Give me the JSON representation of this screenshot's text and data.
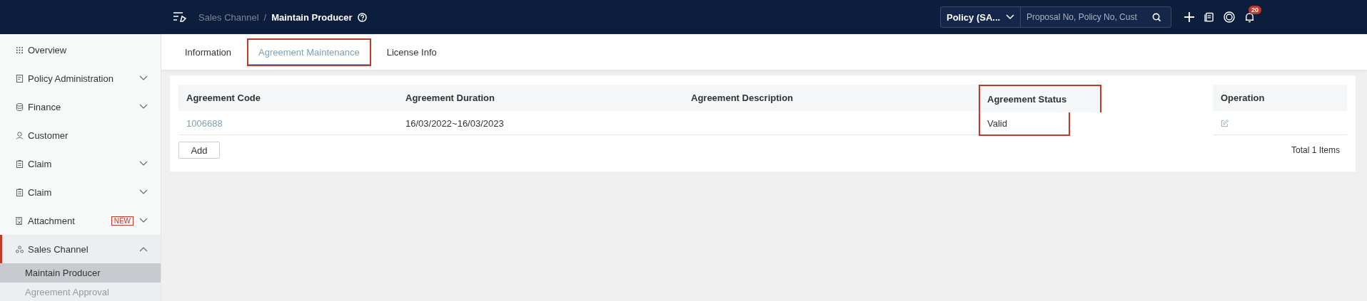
{
  "top_bar": {
    "breadcrumb_separator": "/",
    "breadcrumb": [
      {
        "label": "Sales Channel",
        "current": false
      },
      {
        "label": "Maintain Producer",
        "current": true
      }
    ],
    "search_scope": "Policy (SA...",
    "search": {
      "placeholder": "Proposal No, Policy No, Cust"
    },
    "notification_count": "20"
  },
  "sidebar": {
    "items": [
      {
        "label": "Overview",
        "kind": "grid",
        "selected": false
      },
      {
        "label": "Policy Administration",
        "kind": "doc",
        "expandable": true,
        "expanded": false,
        "selected": false
      },
      {
        "label": "Finance",
        "kind": "coins",
        "expandable": true,
        "expanded": false,
        "selected": false
      },
      {
        "label": "Customer",
        "kind": "user",
        "selected": false
      },
      {
        "label": "Claim",
        "kind": "clip",
        "expandable": true,
        "expanded": false,
        "selected": false
      },
      {
        "label": "Claim",
        "kind": "clip",
        "expandable": true,
        "expanded": false,
        "selected": false
      },
      {
        "label": "Attachment",
        "kind": "attach",
        "badge": "NEW",
        "expandable": true,
        "expanded": false,
        "selected": false
      },
      {
        "label": "Sales Channel",
        "kind": "nodes",
        "expandable": true,
        "expanded": true,
        "selected": true,
        "children": [
          {
            "label": "Maintain Producer",
            "selected": true
          },
          {
            "label": "Agreement Approval",
            "selected": false
          }
        ]
      }
    ]
  },
  "tabs": [
    {
      "label": "Information",
      "selected": false,
      "highlighted": false
    },
    {
      "label": "Agreement Maintenance",
      "selected": true,
      "highlighted": true
    },
    {
      "label": "License Info",
      "selected": false,
      "highlighted": false
    }
  ],
  "table": {
    "columns": [
      {
        "label": "Agreement Code",
        "highlighted": false
      },
      {
        "label": "Agreement Duration",
        "highlighted": false
      },
      {
        "label": "Agreement Description",
        "highlighted": false
      },
      {
        "label": "Agreement Status",
        "highlighted": true
      },
      {
        "label": "Operation",
        "highlighted": false
      }
    ],
    "rows": [
      {
        "code": "1006688",
        "duration": "16/03/2022~16/03/2023",
        "status": "Valid"
      }
    ]
  },
  "add_button": "Add",
  "total": "Total 1 Items"
}
